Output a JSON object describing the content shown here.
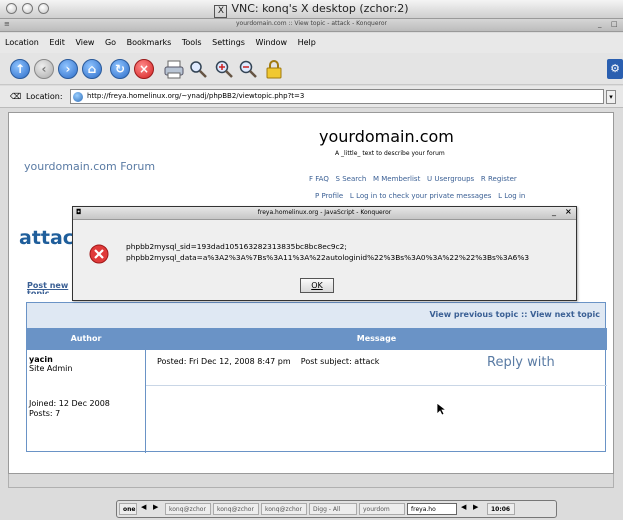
{
  "vnc": {
    "title": "VNC: konq's X desktop (zchor:2)"
  },
  "konqueror": {
    "title": "yourdomain.com :: View topic - attack - Konqueror"
  },
  "menu": [
    "Location",
    "Edit",
    "View",
    "Go",
    "Bookmarks",
    "Tools",
    "Settings",
    "Window",
    "Help"
  ],
  "location": {
    "label": "Location:",
    "url": "http://freya.homelinux.org/~ynadj/phpBB2/viewtopic.php?t=3"
  },
  "site": {
    "name": "yourdomain.com",
    "tagline": "A _little_ text to describe your forum",
    "forum_link": "yourdomain.com Forum",
    "nav1": [
      "FAQ",
      "Search",
      "Memberlist",
      "Usergroups",
      "Register"
    ],
    "nav2": [
      "Profile",
      "Log in to check your private messages",
      "Log in"
    ],
    "topic_title": "attac",
    "post_new": "Post new",
    "post_new2": "topic",
    "view_links": "View previous topic :: View next topic"
  },
  "table": {
    "author_header": "Author",
    "message_header": "Message",
    "post": {
      "author": "yacin",
      "rank": "Site Admin",
      "joined": "Joined: 12 Dec 2008",
      "posts": "Posts: 7",
      "meta": "Posted: Fri Dec 12, 2008 8:47 pm    Post subject: attack",
      "body": "Reply with"
    }
  },
  "dialog": {
    "title": "freya.homelinux.org - JavaScript - Konqueror",
    "line1": "phpbb2mysql_sid=193dad105163282313835bc8bc8ec9c2;",
    "line2": "phpbb2mysql_data=a%3A2%3A%7Bs%3A11%3A%22autologinid%22%3Bs%3A0%3A%22%22%3Bs%3A6%3",
    "ok": "OK"
  },
  "taskbar": {
    "items": [
      "one",
      "konq@zchor",
      "konq@zchor",
      "konq@zchor",
      "Digg - All",
      "yourdom",
      "freya.ho"
    ],
    "clock": "10:06"
  }
}
